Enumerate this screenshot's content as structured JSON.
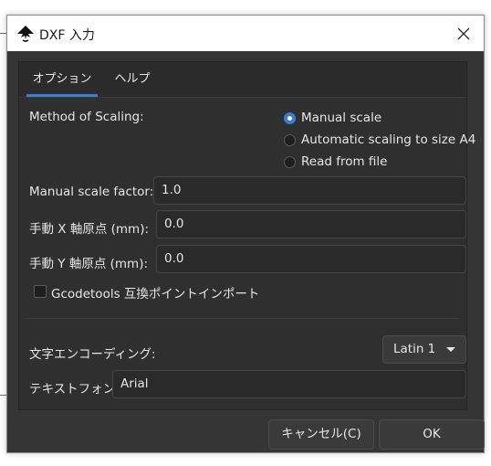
{
  "window": {
    "title": "DXF 入力"
  },
  "tabs": [
    {
      "label": "オプション",
      "active": true
    },
    {
      "label": "ヘルプ",
      "active": false
    }
  ],
  "scaling": {
    "label": "Method of Scaling:",
    "options": [
      {
        "label": "Manual scale",
        "selected": true
      },
      {
        "label": "Automatic scaling to size A4",
        "selected": false
      },
      {
        "label": "Read from file",
        "selected": false
      }
    ]
  },
  "fields": {
    "scale_label": "Manual scale factor:",
    "scale_value": "1.0",
    "x_origin_label": "手動 X 軸原点 (mm):",
    "x_origin_value": "0.0",
    "y_origin_label": "手動 Y 軸原点 (mm):",
    "y_origin_value": "0.0"
  },
  "gcodetools": {
    "label": "Gcodetools 互換ポイントインポート",
    "checked": false
  },
  "encoding": {
    "label": "文字エンコーディング:",
    "value": "Latin 1"
  },
  "font": {
    "label": "テキストフォント:",
    "value": "Arial"
  },
  "buttons": {
    "cancel": "キャンセル(C)",
    "ok": "OK"
  },
  "colors": {
    "accent": "#3e7bd6",
    "panel": "#2f2f2f",
    "window": "#353535"
  }
}
